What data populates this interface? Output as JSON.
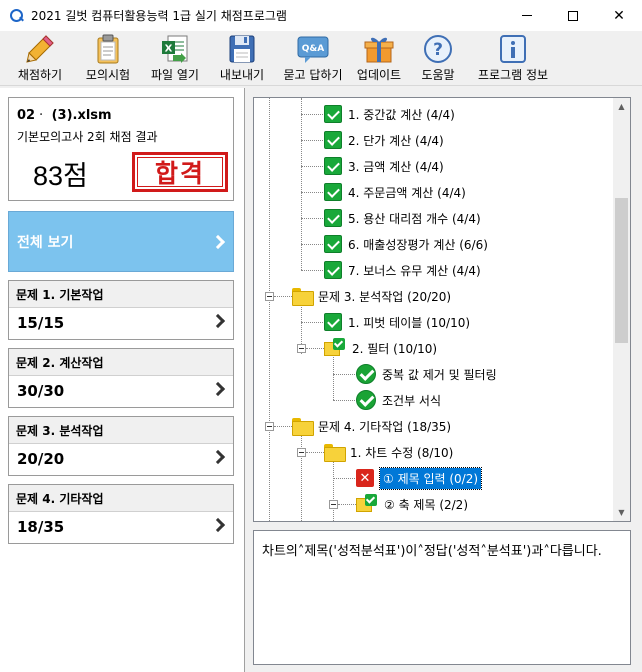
{
  "window": {
    "title": "2021 길벗 컴퓨터활용능력 1급 실기 채점프로그램",
    "minimize": "—",
    "maximize": "□",
    "close": "✕"
  },
  "toolbar": [
    {
      "label": "채점하기",
      "icon": "pencil-icon"
    },
    {
      "label": "모의시험",
      "icon": "clipboard-icon"
    },
    {
      "label": "파일 열기",
      "icon": "excel-file-icon"
    },
    {
      "label": "내보내기",
      "icon": "floppy-disk-icon"
    },
    {
      "label": "묻고 답하기",
      "icon": "qa-icon"
    },
    {
      "label": "업데이트",
      "icon": "gift-icon"
    },
    {
      "label": "도움말",
      "icon": "help-icon"
    },
    {
      "label": "프로그램 정보",
      "icon": "info-icon"
    }
  ],
  "result": {
    "file_name": "02ᆞ (3).xlsm",
    "exam_title": "기본모의고사 2회 채점 결과",
    "score": "83점",
    "pass_label": "합격"
  },
  "view_all": "전체 보기",
  "questions": [
    {
      "title": "문제 1. 기본작업",
      "score": "15/15"
    },
    {
      "title": "문제 2. 계산작업",
      "score": "30/30"
    },
    {
      "title": "문제 3. 분석작업",
      "score": "20/20"
    },
    {
      "title": "문제 4. 기타작업",
      "score": "18/35"
    }
  ],
  "tree": {
    "items": [
      {
        "label": "1. 중간값 계산 (4/4)"
      },
      {
        "label": "2. 단가 계산 (4/4)"
      },
      {
        "label": "3. 금액 계산 (4/4)"
      },
      {
        "label": "4. 주문금액 계산 (4/4)"
      },
      {
        "label": "5. 용산 대리점 개수 (4/4)"
      },
      {
        "label": "6. 매출성장평가 계산 (6/6)"
      },
      {
        "label": "7. 보너스 유무 계산 (4/4)"
      },
      {
        "label": "문제 3. 분석작업 (20/20)"
      },
      {
        "label": "1. 피벗 테이블 (10/10)"
      },
      {
        "label": "2. 필터 (10/10)"
      },
      {
        "label": "중복 값 제거 및 필터링"
      },
      {
        "label": "조건부 서식"
      },
      {
        "label": "문제 4. 기타작업 (18/35)"
      },
      {
        "label": "1. 차트 수정 (8/10)"
      },
      {
        "label": "① 제목 입력 (0/2)"
      },
      {
        "label": "② 축 제목 (2/2)"
      }
    ]
  },
  "message": "차트의˄제목('성적분석표')이˄정답('성적˄분석표')과˄다릅니다."
}
